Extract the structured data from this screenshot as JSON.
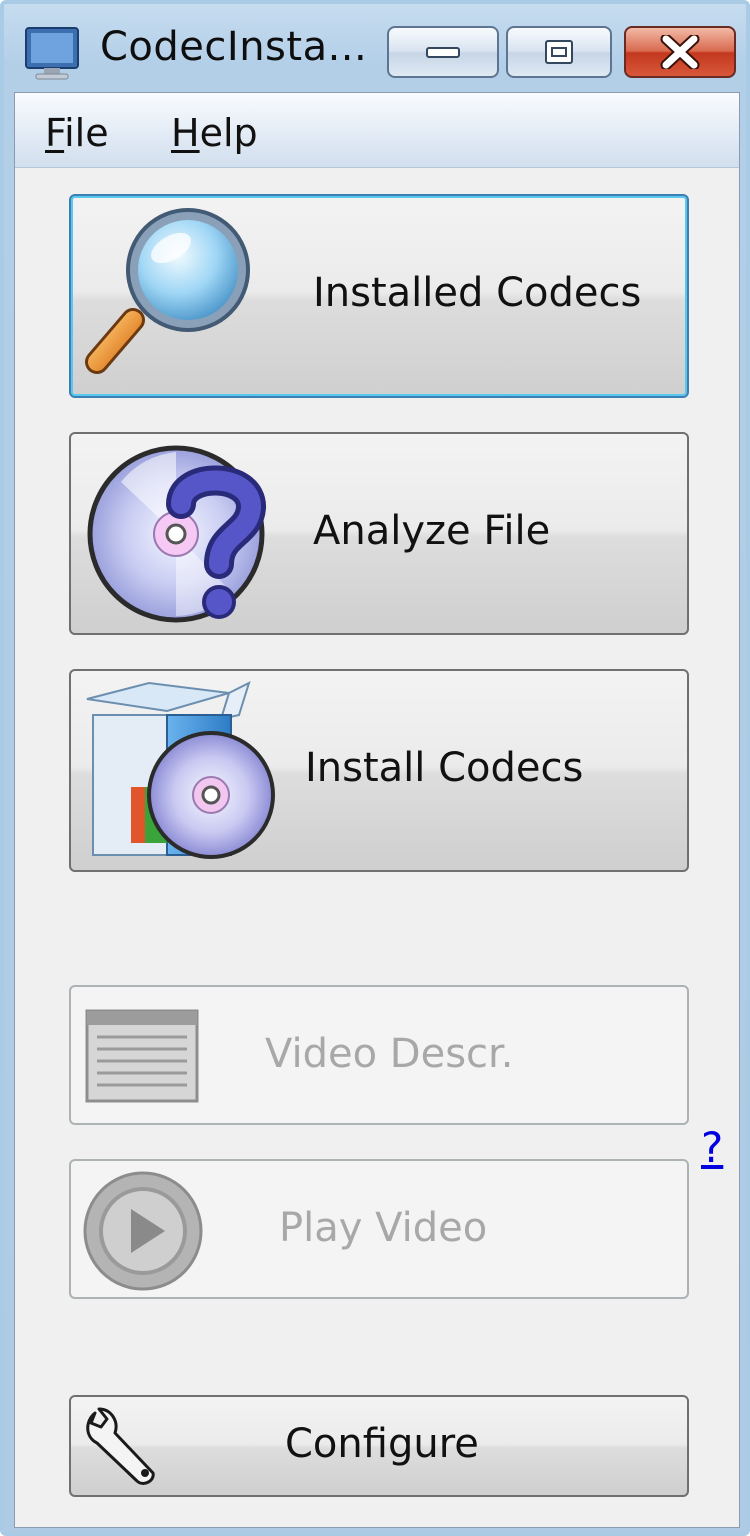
{
  "window": {
    "title": "CodecInsta...",
    "icons": {
      "app": "monitor-icon",
      "minimize": "minimize-icon",
      "maximize": "maximize-icon",
      "close": "close-icon"
    }
  },
  "menu": {
    "file": {
      "mnemonic": "F",
      "rest": "ile"
    },
    "help": {
      "mnemonic": "H",
      "rest": "elp"
    }
  },
  "buttons": {
    "installed_codecs": {
      "label": "Installed Codecs",
      "icon": "magnifier-icon"
    },
    "analyze_file": {
      "label": "Analyze File",
      "icon": "disc-question-icon"
    },
    "install_codecs": {
      "label": "Install Codecs",
      "icon": "box-disc-icon"
    },
    "video_descr": {
      "label": "Video Descr.",
      "icon": "document-icon",
      "enabled": false
    },
    "play_video": {
      "label": "Play Video",
      "icon": "play-icon",
      "enabled": false
    },
    "configure": {
      "label": "Configure",
      "icon": "wrench-icon"
    }
  },
  "help_link": "?",
  "colors": {
    "focus_border": "#58c8f0",
    "close_button": "#c3381f",
    "link": "#0000e0"
  }
}
